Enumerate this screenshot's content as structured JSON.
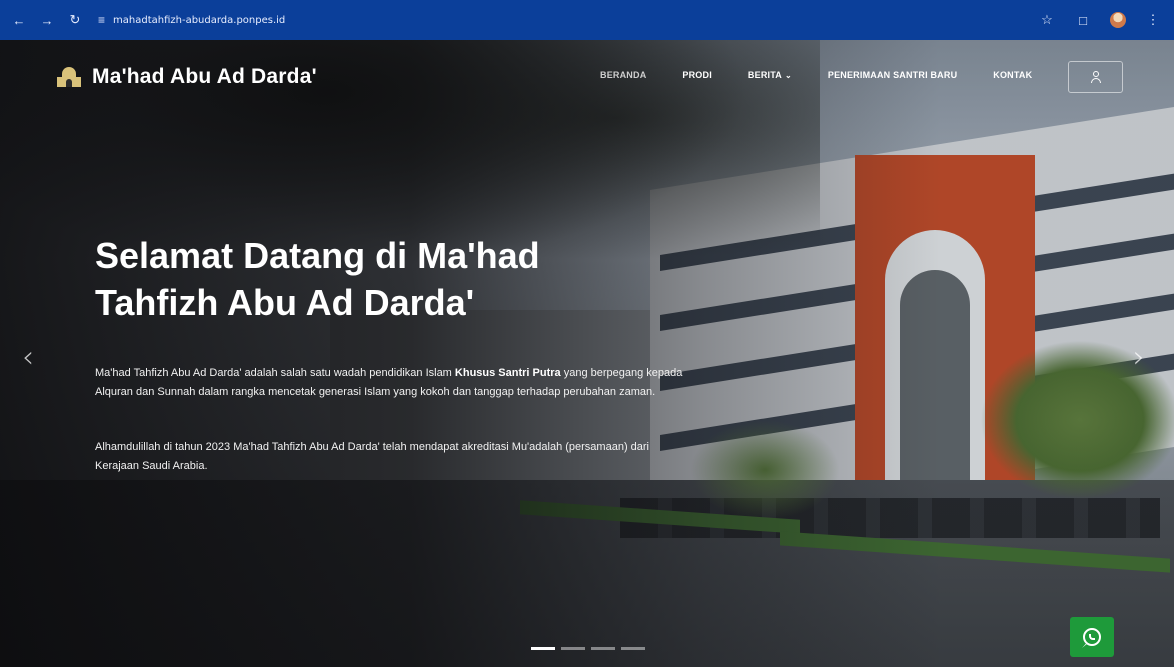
{
  "browser": {
    "url": "mahadtahfizh-abudarda.ponpes.id",
    "icons": [
      "back-arrow-icon",
      "forward-arrow-icon",
      "reload-icon",
      "site-settings-icon",
      "bookmark-star-icon",
      "extensions-icon",
      "profile-avatar",
      "more-menu-icon"
    ]
  },
  "site": {
    "title": "Ma'had Abu Ad Darda'",
    "menu": [
      {
        "label": "BERANDA",
        "active": true
      },
      {
        "label": "PRODI",
        "active": false
      },
      {
        "label": "BERITA",
        "active": false,
        "has_dropdown": true
      },
      {
        "label": "PENERIMAAN SANTRI BARU",
        "active": false
      },
      {
        "label": "KONTAK",
        "active": false
      }
    ]
  },
  "hero": {
    "title": "Selamat Datang di Ma'had Tahfizh Abu Ad Darda'",
    "p1_before": "Ma'had Tahfizh Abu Ad Darda' adalah salah satu wadah pendidikan Islam ",
    "p1_bold": "Khusus Santri Putra",
    "p1_after": " yang berpegang kepada Alquran dan Sunnah dalam rangka mencetak generasi Islam yang kokoh dan tanggap terhadap perubahan zaman.",
    "p2": "Alhamdulillah di tahun 2023 Ma'had Tahfizh Abu Ad Darda' telah mendapat akreditasi Mu'adalah (persamaan) dari Kerajaan Saudi Arabia.",
    "prev_glyph": "‹",
    "next_glyph": "›",
    "slides_total": 4,
    "active_slide": 1
  },
  "colors": {
    "browser_bar": "#0b3f9a",
    "whatsapp": "#1e9a3a",
    "arch": "#b84a2a"
  }
}
